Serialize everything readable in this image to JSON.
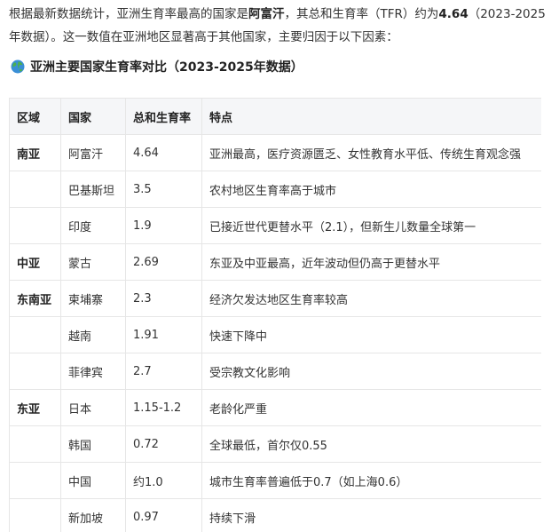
{
  "intro": {
    "part1": "根据最新数据统计，亚洲生育率最高的国家是",
    "country": "阿富汗",
    "part2": "，其总和生育率（TFR）约为",
    "tfr": "4.64",
    "part3": "（2023-2025年数据）。这一数值在亚洲地区显著高于其他国家，主要归因于以下因素："
  },
  "heading": {
    "icon": "globe-icon",
    "title": "亚洲主要国家生育率对比（2023-2025年数据）"
  },
  "table": {
    "headers": [
      "区域",
      "国家",
      "总和生育率",
      "特点"
    ],
    "rows": [
      [
        "南亚",
        "阿富汗",
        "4.64",
        "亚洲最高，医疗资源匮乏、女性教育水平低、传统生育观念强"
      ],
      [
        "",
        "巴基斯坦",
        "3.5",
        "农村地区生育率高于城市"
      ],
      [
        "",
        "印度",
        "1.9",
        "已接近世代更替水平（2.1），但新生儿数量全球第一"
      ],
      [
        "中亚",
        "蒙古",
        "2.69",
        "东亚及中亚最高，近年波动但仍高于更替水平"
      ],
      [
        "东南亚",
        "柬埔寨",
        "2.3",
        "经济欠发达地区生育率较高"
      ],
      [
        "",
        "越南",
        "1.91",
        "快速下降中"
      ],
      [
        "",
        "菲律宾",
        "2.7",
        "受宗教文化影响"
      ],
      [
        "东亚",
        "日本",
        "1.15-1.2",
        "老龄化严重"
      ],
      [
        "",
        "韩国",
        "0.72",
        "全球最低，首尔仅0.55"
      ],
      [
        "",
        "中国",
        "约1.0",
        "城市生育率普遍低于0.7（如上海0.6）"
      ],
      [
        "",
        "新加坡",
        "0.97",
        "持续下滑"
      ]
    ]
  }
}
